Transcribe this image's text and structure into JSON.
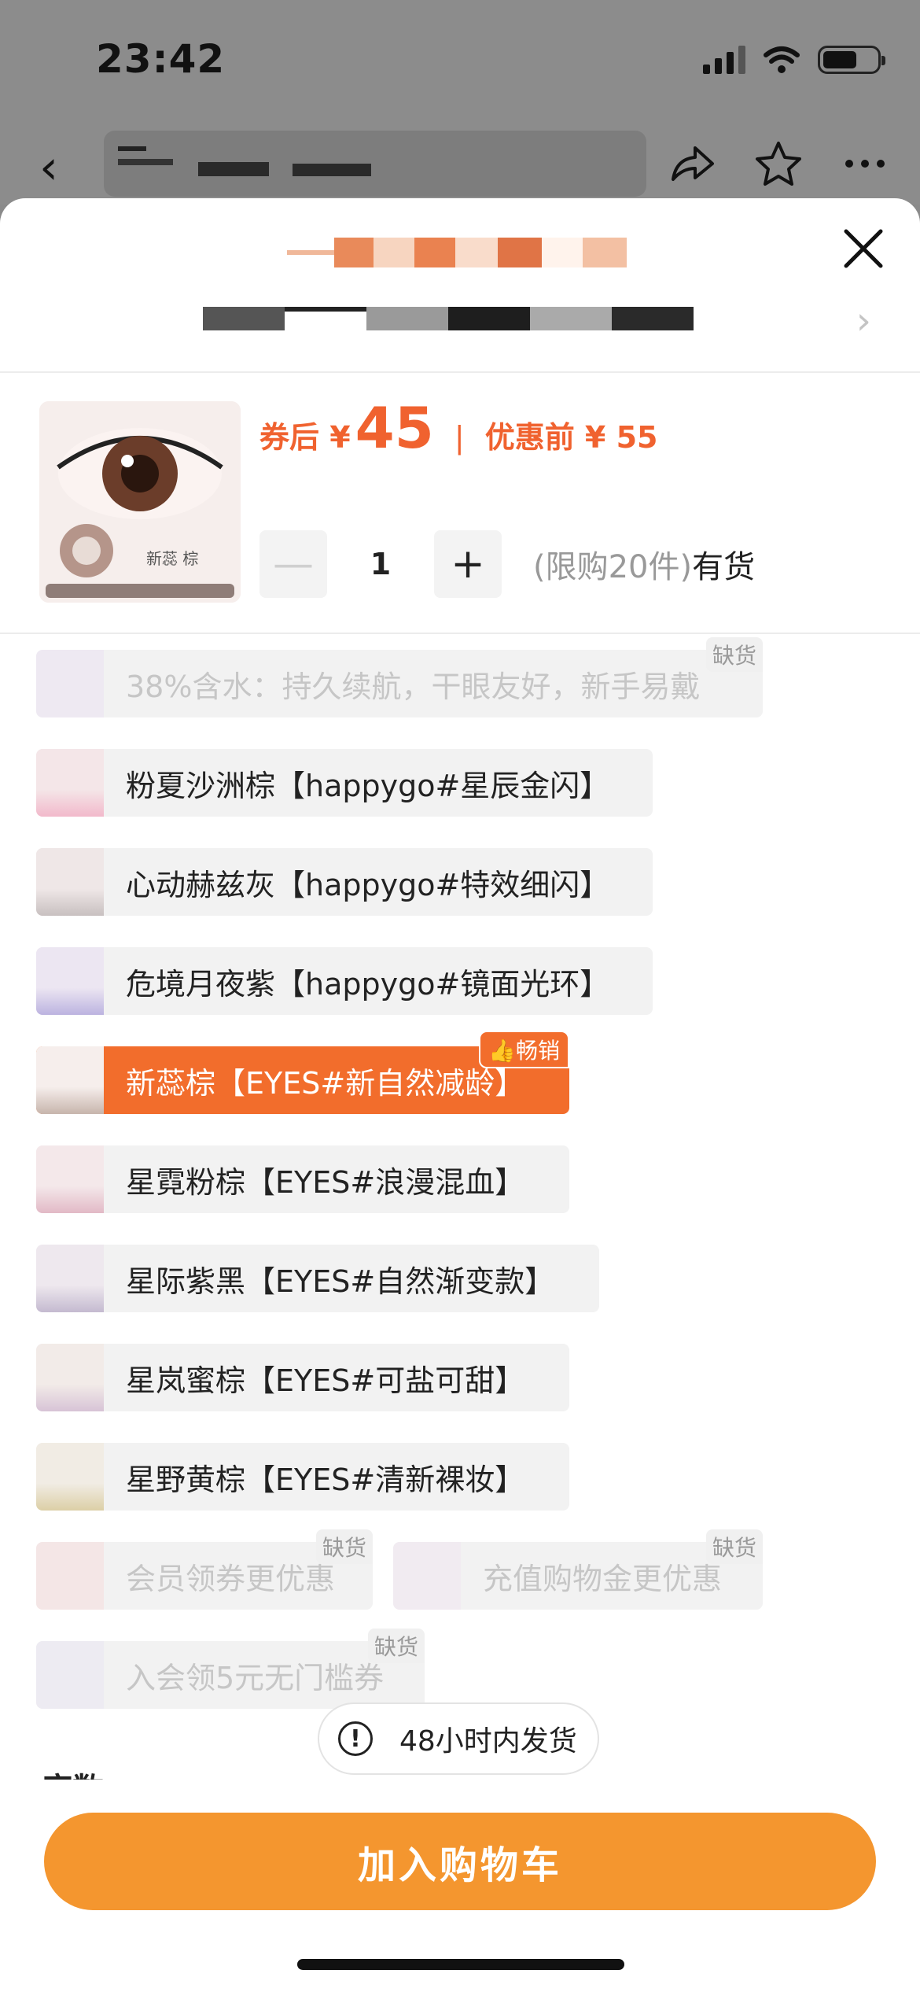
{
  "status_bar": {
    "time": "23:42"
  },
  "price": {
    "after_label": "券后 ¥",
    "after_value": "45",
    "separator": "|",
    "before_label": "优惠前 ¥ 55"
  },
  "quantity": {
    "minus": "—",
    "value": "1",
    "plus": "+",
    "limit_text": "(限购20件)",
    "stock_text": "有货"
  },
  "thumbnail": {
    "color_name": "新蕊 棕"
  },
  "options": [
    {
      "label": "38%含水：持久续航，干眼友好，新手易戴",
      "state": "disabled",
      "tag": "缺货"
    },
    {
      "label": "粉夏沙洲棕【happygo#星辰金闪】",
      "state": "normal",
      "tag": ""
    },
    {
      "label": "心动赫兹灰【happygo#特效细闪】",
      "state": "normal",
      "tag": ""
    },
    {
      "label": "危境月夜紫【happygo#镜面光环】",
      "state": "normal",
      "tag": ""
    },
    {
      "label": "新蕊棕【EYES#新自然减龄】",
      "state": "selected",
      "tag": "畅销"
    },
    {
      "label": "星霓粉棕【EYES#浪漫混血】",
      "state": "normal",
      "tag": ""
    },
    {
      "label": "星际紫黑【EYES#自然渐变款】",
      "state": "normal",
      "tag": ""
    },
    {
      "label": "星岚蜜棕【EYES#可盐可甜】",
      "state": "normal",
      "tag": ""
    },
    {
      "label": "星野黄棕【EYES#清新裸妆】",
      "state": "normal",
      "tag": ""
    },
    {
      "label": "会员领券更优惠",
      "state": "disabled",
      "tag": "缺货"
    },
    {
      "label": "充值购物金更优惠",
      "state": "disabled",
      "tag": "缺货"
    },
    {
      "label": "入会领5元无门槛券",
      "state": "disabled",
      "tag": "缺货"
    }
  ],
  "shipping_notice": "48小时内发货",
  "partial_section_title": "度数",
  "add_to_cart": "加入购物车",
  "colors": {
    "accent_orange": "#f26d2c",
    "cart_button": "#f4962f",
    "price_red": "#f0622f"
  }
}
